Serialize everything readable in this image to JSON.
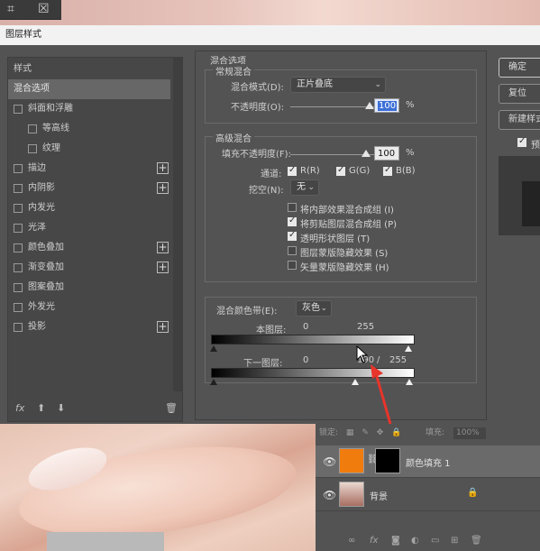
{
  "toolbar": {
    "crop_icon": "crop-icon",
    "frame_icon": "frame-icon"
  },
  "dialog": {
    "title": "图层样式",
    "style_list": {
      "header": "样式",
      "items": [
        {
          "label": "混合选项",
          "selected": true,
          "checkbox": false,
          "plus": false
        },
        {
          "label": "斜面和浮雕",
          "checkbox": true,
          "plus": false
        },
        {
          "label": "等高线",
          "checkbox": true,
          "plus": false,
          "indent": true
        },
        {
          "label": "纹理",
          "checkbox": true,
          "plus": false,
          "indent": true
        },
        {
          "label": "描边",
          "checkbox": true,
          "plus": true
        },
        {
          "label": "内阴影",
          "checkbox": true,
          "plus": true
        },
        {
          "label": "内发光",
          "checkbox": true,
          "plus": false
        },
        {
          "label": "光泽",
          "checkbox": true,
          "plus": false
        },
        {
          "label": "颜色叠加",
          "checkbox": true,
          "plus": true
        },
        {
          "label": "渐变叠加",
          "checkbox": true,
          "plus": true
        },
        {
          "label": "图案叠加",
          "checkbox": true,
          "plus": false
        },
        {
          "label": "外发光",
          "checkbox": true,
          "plus": false
        },
        {
          "label": "投影",
          "checkbox": true,
          "plus": true
        }
      ],
      "footer_fx": "fx"
    },
    "blend_options": {
      "title": "混合选项",
      "general": {
        "title": "常规混合",
        "mode_label": "混合模式(D):",
        "mode_value": "正片叠底",
        "opacity_label": "不透明度(O):",
        "opacity_value": "100",
        "opacity_level": 1.0,
        "percent": "%"
      },
      "advanced": {
        "title": "高级混合",
        "fill_opacity_label": "填充不透明度(F):",
        "fill_opacity_value": "100",
        "fill_opacity_level": 1.0,
        "percent": "%",
        "channels_label": "通道:",
        "channel_r": "R(R)",
        "channel_g": "G(G)",
        "channel_b": "B(B)",
        "knockout_label": "挖空(N):",
        "knockout_value": "无",
        "options": [
          {
            "label": "将内部效果混合成组 (I)",
            "checked": false
          },
          {
            "label": "将剪贴图层混合成组 (P)",
            "checked": true
          },
          {
            "label": "透明形状图层 (T)",
            "checked": true
          },
          {
            "label": "图层蒙版隐藏效果 (S)",
            "checked": false
          },
          {
            "label": "矢量蒙版隐藏效果 (H)",
            "checked": false
          }
        ]
      },
      "blend_if": {
        "label": "混合颜色带(E):",
        "value": "灰色",
        "this_layer_label": "本图层:",
        "this_layer_min": "0",
        "this_layer_max": "255",
        "underlying_label": "下一图层:",
        "underlying_min": "0",
        "underlying_split": "190",
        "slash": "/",
        "underlying_max": "255"
      }
    },
    "buttons": {
      "ok": "确定",
      "cancel": "复位",
      "new_style": "新建样式...",
      "preview": "预览"
    }
  },
  "layers": {
    "lock_label": "锁定:",
    "fill_label": "填充:",
    "fill_value": "100%",
    "rows": [
      {
        "name": "颜色填充 1",
        "selected": true,
        "thumb_color": "#f07c0e"
      },
      {
        "name": "背景",
        "selected": false,
        "locked": true
      }
    ]
  },
  "colors": {
    "dialog_bg": "#535353",
    "accent_blue": "#3b6fd6",
    "arrow_red": "#e8342b",
    "fill_orange": "#f07c0e"
  }
}
